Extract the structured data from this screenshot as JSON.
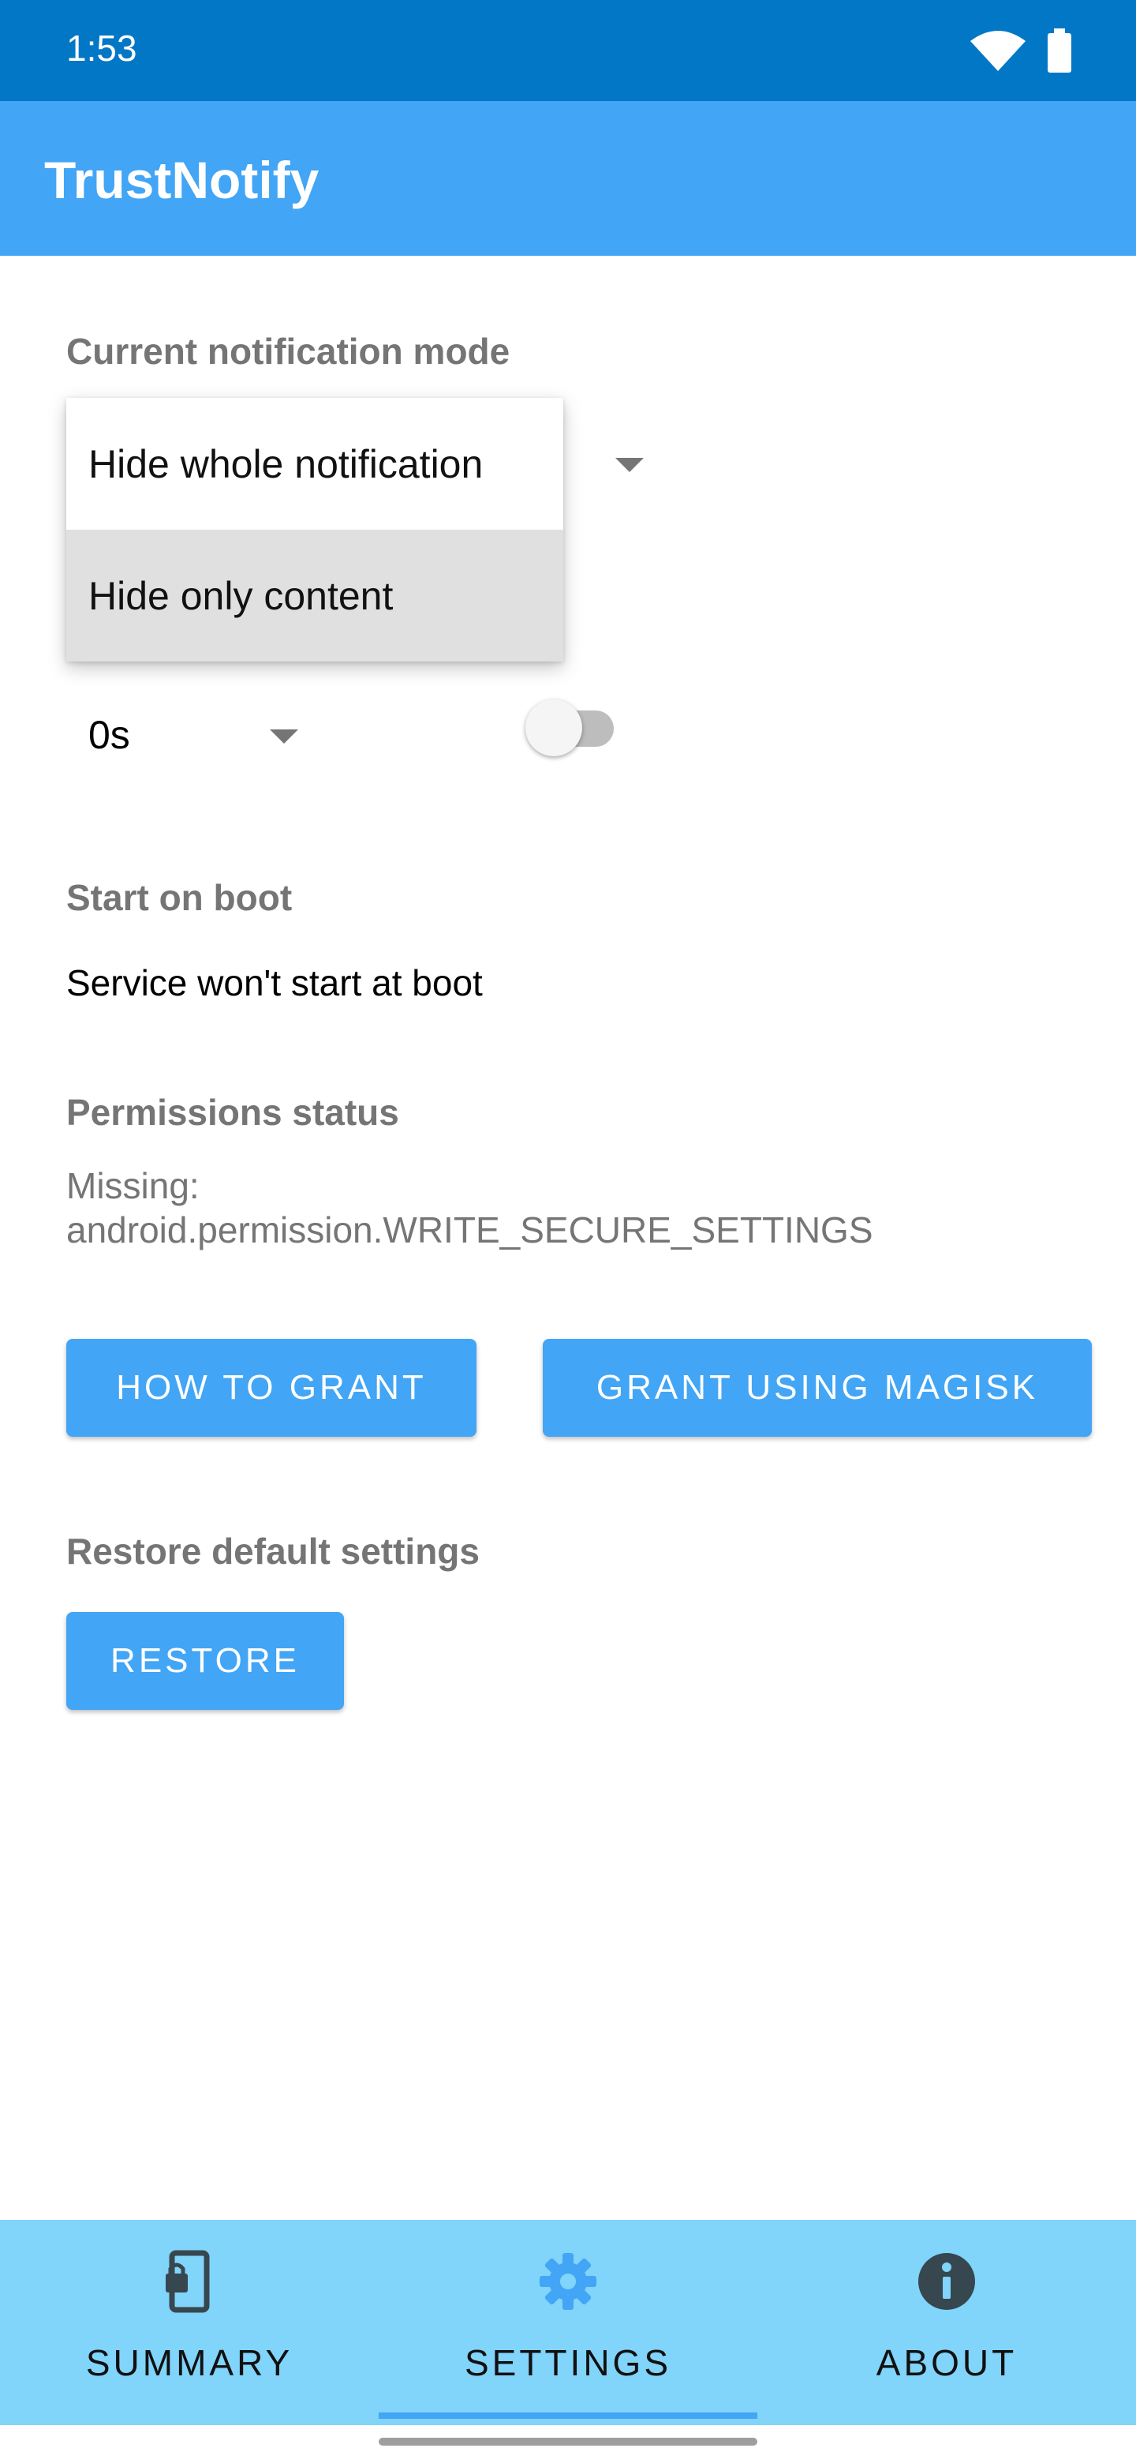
{
  "status_bar": {
    "time": "1:53",
    "icons": [
      "wifi-icon",
      "battery-icon"
    ]
  },
  "app_bar": {
    "title": "TrustNotify"
  },
  "settings": {
    "notification_mode": {
      "label": "Current notification mode",
      "options": [
        "Hide whole notification",
        "Hide only content"
      ],
      "selected": "Hide only content"
    },
    "delay": {
      "value": "0s"
    },
    "start_on_boot": {
      "label": "Start on boot",
      "description": "Service won't start at boot",
      "enabled": false
    },
    "permissions": {
      "label": "Permissions status",
      "status_line1": "Missing:",
      "status_line2": "android.permission.WRITE_SECURE_SETTINGS",
      "how_to_grant": "HOW TO GRANT",
      "grant_magisk": "GRANT USING MAGISK"
    },
    "restore": {
      "label": "Restore default settings",
      "button": "RESTORE"
    }
  },
  "bottom_nav": {
    "items": [
      {
        "label": "SUMMARY",
        "icon": "phone-lock-icon"
      },
      {
        "label": "SETTINGS",
        "icon": "gear-icon",
        "active": true
      },
      {
        "label": "ABOUT",
        "icon": "info-icon"
      }
    ]
  },
  "colors": {
    "status_bar": "#0277C6",
    "primary": "#42A5F5",
    "bottom_nav": "#81D4FA",
    "section_label": "#757575"
  }
}
